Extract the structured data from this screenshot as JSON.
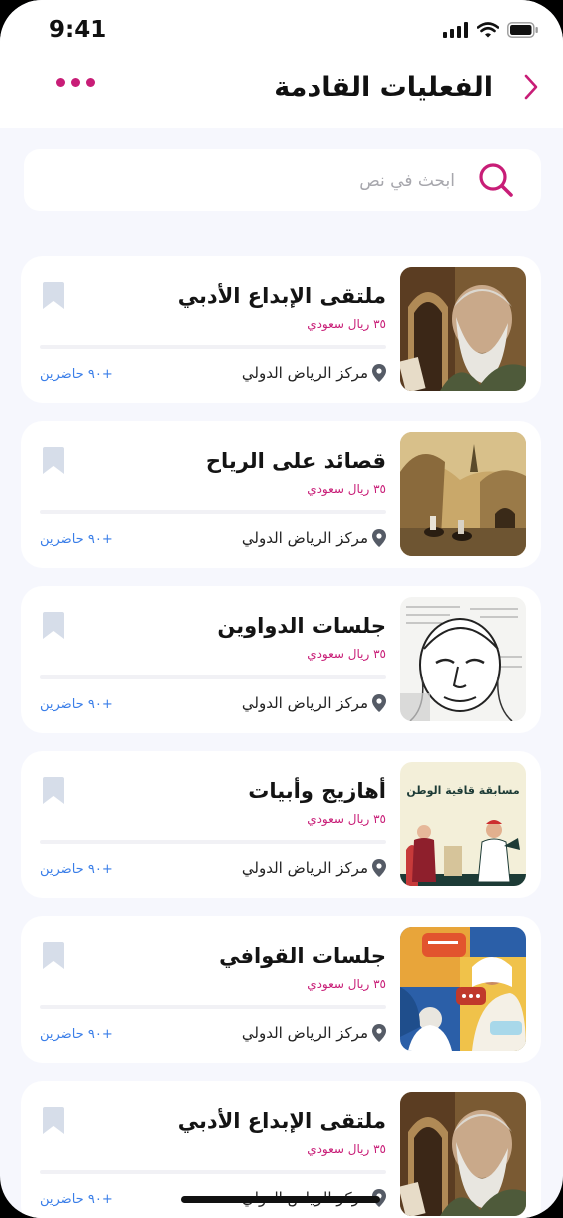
{
  "status_bar": {
    "time": "9:41"
  },
  "header": {
    "title": "الفعليات القادمة"
  },
  "search": {
    "placeholder": "ابحث في نص"
  },
  "colors": {
    "accent": "#c81d77",
    "attendees": "#3a7ee8",
    "bookmark": "#d6dde9"
  },
  "events": [
    {
      "title": "ملتقى الإبداع الأدبي",
      "price": "٣٥ ريال سعودي",
      "location": "مركز الرياض الدولي",
      "attendees": "+٩٠ حاضرين",
      "image": "elder-portrait"
    },
    {
      "title": "قصائد على الرياح",
      "price": "٣٥ ريال سعودي",
      "location": "مركز الرياض الدولي",
      "attendees": "+٩٠ حاضرين",
      "image": "desert-caravan-painting"
    },
    {
      "title": "جلسات الدواوين",
      "price": "٣٥ ريال سعودي",
      "location": "مركز الرياض الدولي",
      "attendees": "+٩٠ حاضرين",
      "image": "sketch-poet-portrait"
    },
    {
      "title": "أهازيج وأبيات",
      "price": "٣٥ ريال سعودي",
      "location": "مركز الرياض الدولي",
      "attendees": "+٩٠ حاضرين",
      "image": "poetry-competition-illustration",
      "image_text": "مسابقة قافية الوطن"
    },
    {
      "title": "جلسات القوافي",
      "price": "٣٥ ريال سعودي",
      "location": "مركز الرياض الدولي",
      "attendees": "+٩٠ حاضرين",
      "image": "colorful-conversation-illustration"
    },
    {
      "title": "ملتقى الإبداع الأدبي",
      "price": "٣٥ ريال سعودي",
      "location": "مركز الرياض الدولي",
      "attendees": "+٩٠ حاضرين",
      "image": "elder-portrait"
    }
  ]
}
